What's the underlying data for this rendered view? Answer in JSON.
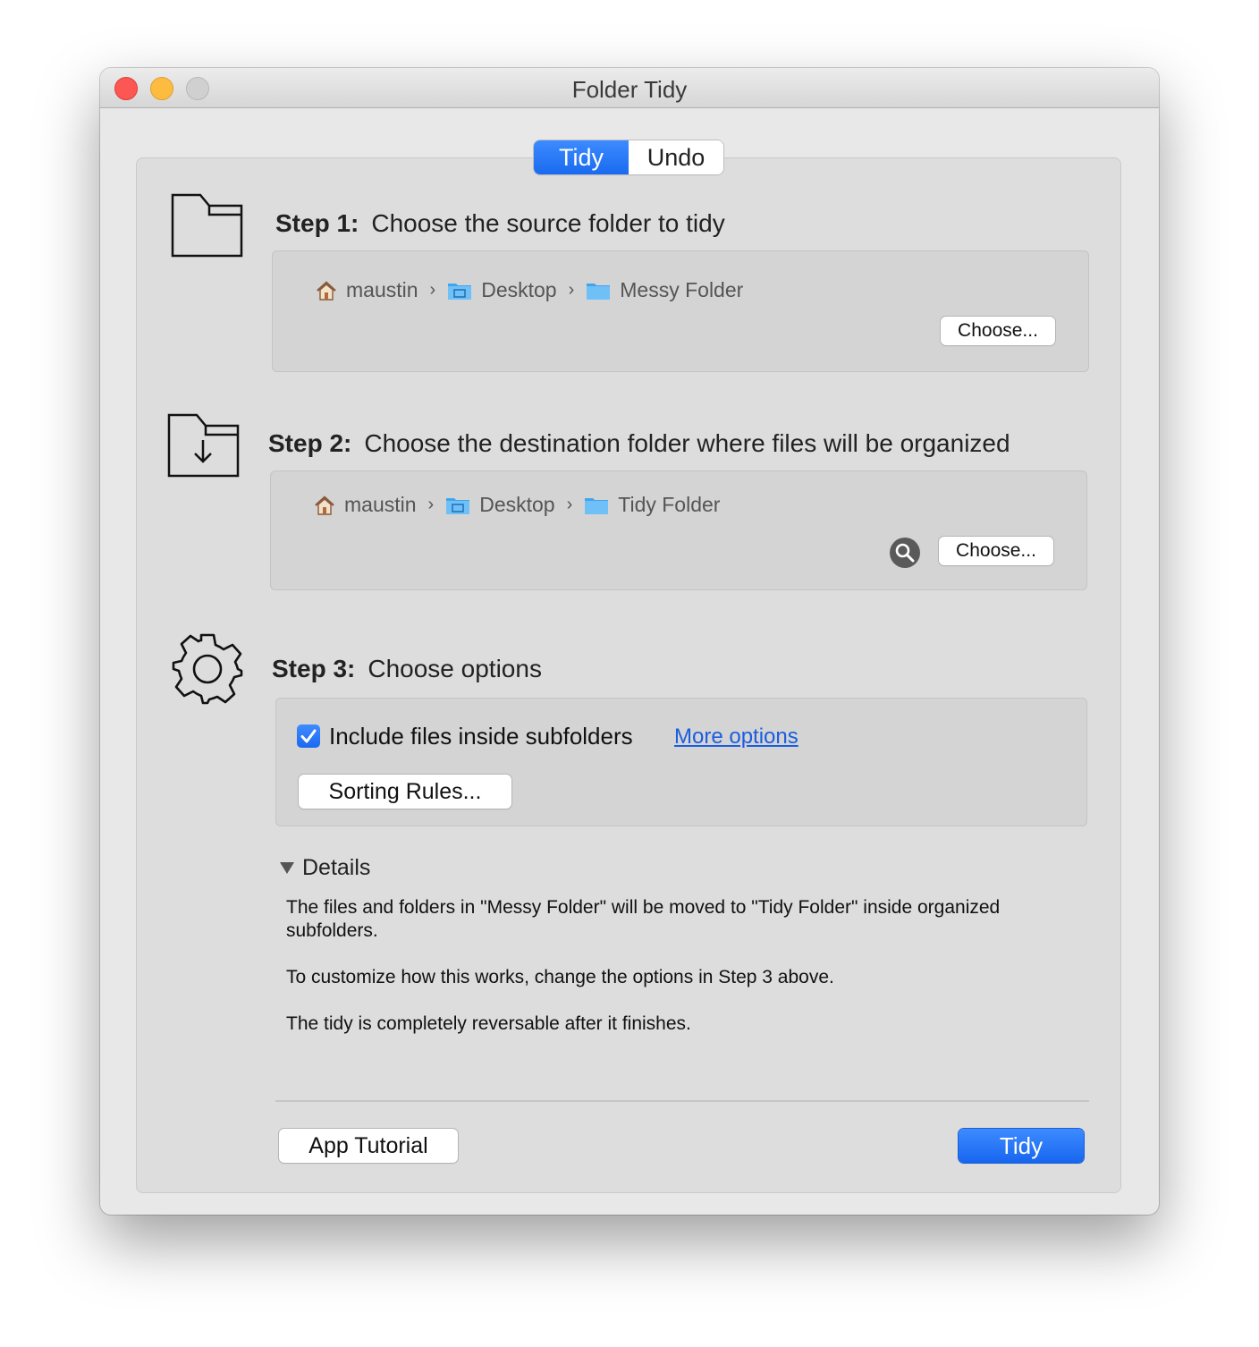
{
  "window": {
    "title": "Folder Tidy"
  },
  "tabs": {
    "tidy": "Tidy",
    "undo": "Undo"
  },
  "step1": {
    "label": "Step 1:",
    "text": "Choose the source folder to tidy",
    "path": [
      "maustin",
      "Desktop",
      "Messy Folder"
    ],
    "choose": "Choose..."
  },
  "step2": {
    "label": "Step 2:",
    "text": "Choose the destination folder where files will be organized",
    "path": [
      "maustin",
      "Desktop",
      "Tidy Folder"
    ],
    "choose": "Choose..."
  },
  "step3": {
    "label": "Step 3:",
    "text": "Choose options",
    "include_subfolders": "Include files inside subfolders",
    "include_checked": true,
    "more_options": "More options",
    "sorting_rules": "Sorting Rules..."
  },
  "details": {
    "label": "Details",
    "para1": "The files and folders in \"Messy Folder\" will be moved to \"Tidy Folder\" inside organized subfolders.",
    "para2": "To customize how this works, change the options in Step 3 above.",
    "para3": "The tidy is completely reversable after it finishes."
  },
  "footer": {
    "tutorial": "App Tutorial",
    "tidy": "Tidy"
  },
  "colors": {
    "accent": "#1a6af0",
    "link": "#1a5ee0",
    "close": "#fc5753",
    "minimize": "#fdbc40"
  }
}
